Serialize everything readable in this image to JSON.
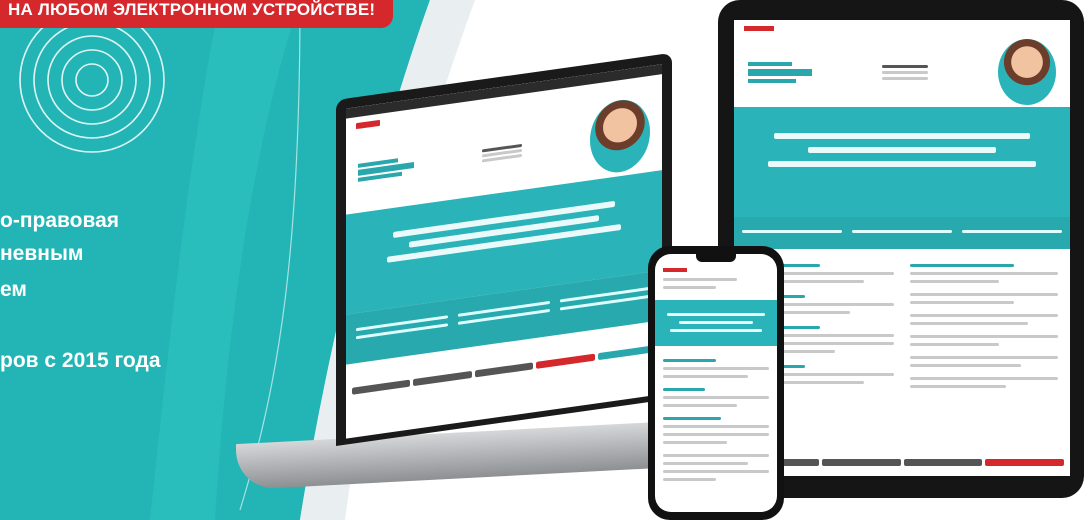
{
  "banner": {
    "ribbon_text": "НА ЛЮБОМ ЭЛЕКТРОННОМ УСТРОЙСТВЕ!",
    "features": [
      "о-правовая",
      "невным",
      "ем",
      "ров с 2015 года"
    ]
  },
  "colors": {
    "teal": "#2ab3b8",
    "red": "#d4282d"
  }
}
